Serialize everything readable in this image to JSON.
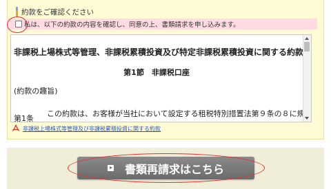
{
  "section": {
    "heading": "約款をご確認ください"
  },
  "agreement": {
    "checkbox_label": "私は、以下の約款の内容を確認し、同意の上、書類請求を申し込みます。"
  },
  "terms": {
    "title": "非課税上場株式等管理、非課税累積投資及び特定非課税累積投資に関する約款",
    "section_heading": "第1節　非課税口座",
    "purpose_heading": "(約款の趣旨)",
    "article_label": "第1条",
    "article_text": "この約款は、お客様が当社において設定する租税特別措置法第９条の８に規定"
  },
  "pdf_link": {
    "label": "非課税上場株式等管理及び非課税累積投資に関する約款",
    "icon": "pdf-icon"
  },
  "action": {
    "button_label": "書類再請求はこちら",
    "icon": "arrow-right-icon"
  },
  "colors": {
    "panel_bg": "#fffbd5",
    "agree_bg": "#ffdbe2",
    "highlight_ring": "#e0322e",
    "button_bg": "#6b6b6b",
    "link": "#2b57b3"
  }
}
